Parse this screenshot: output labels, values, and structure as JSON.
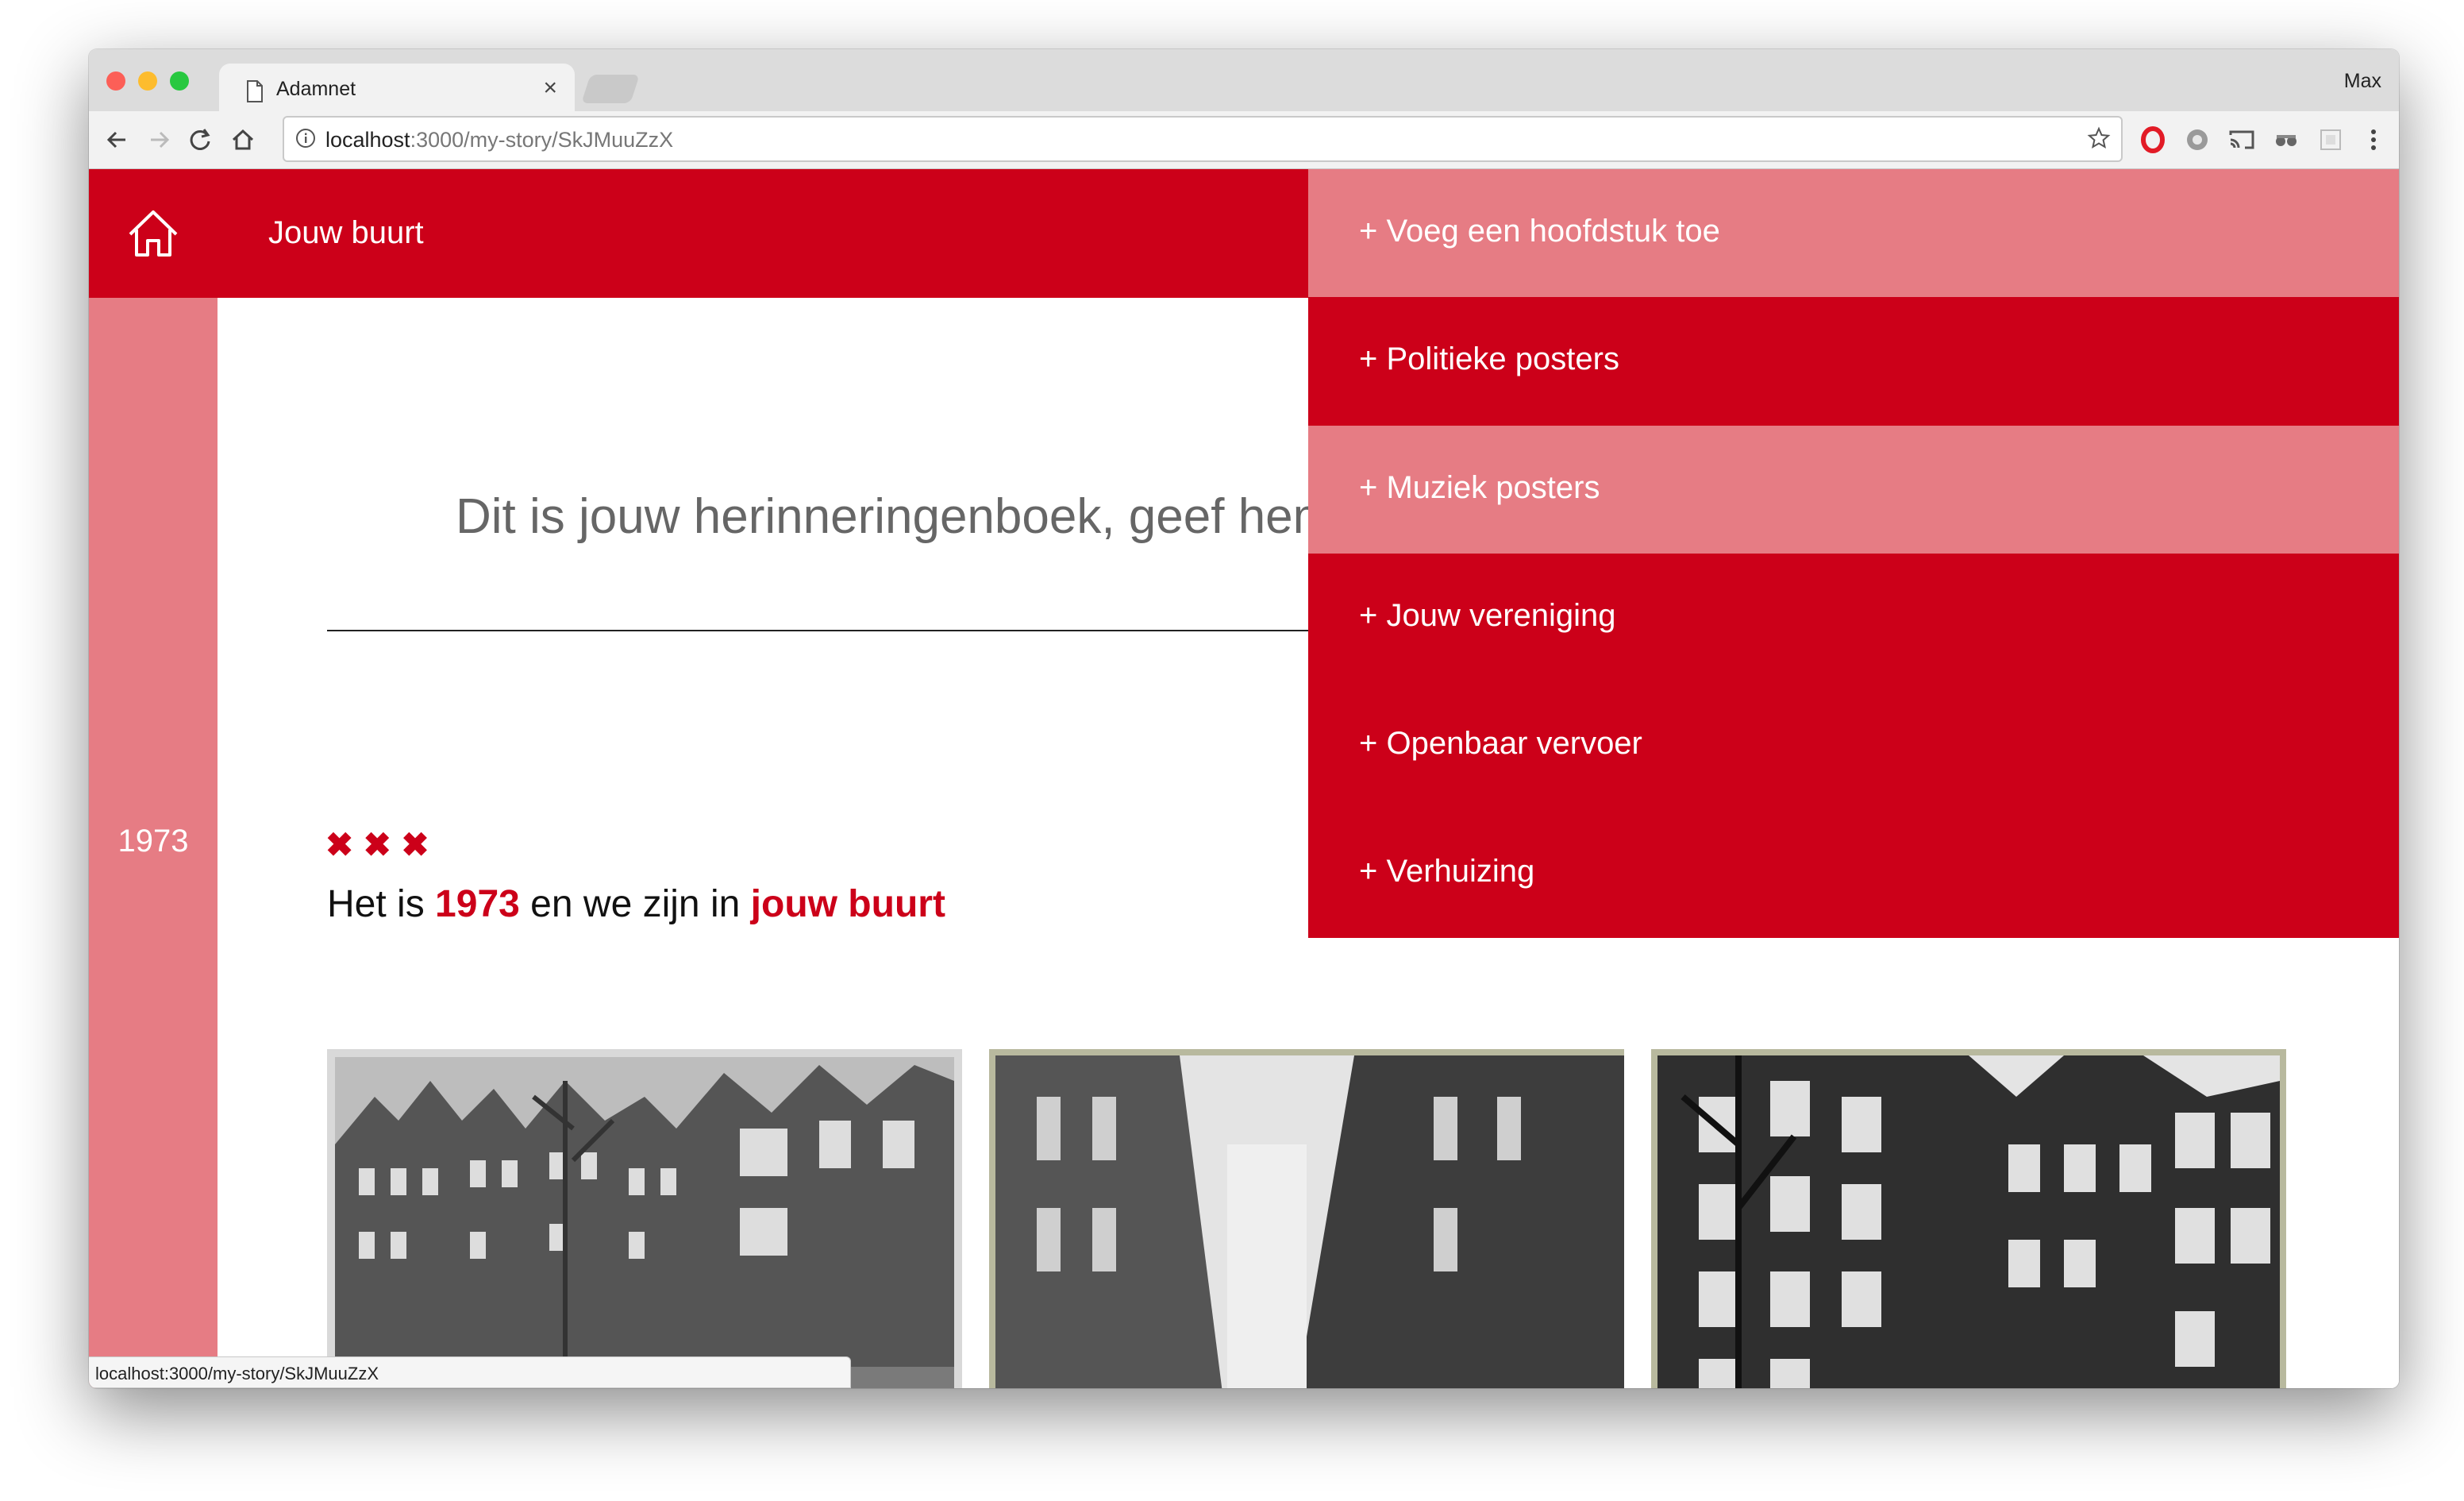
{
  "browser": {
    "tab_title": "Adamnet",
    "profile_name": "Max",
    "url_host": "localhost",
    "url_rest": ":3000/my-story/SkJMuuZzX",
    "status_url": "localhost:3000/my-story/SkJMuuZzX"
  },
  "header": {
    "title": "Jouw buurt"
  },
  "sidebar": {
    "year": "1973"
  },
  "intro": {
    "placeholder": "Dit is jouw herinneringenboek, geef hem hie"
  },
  "chapter": {
    "marks": [
      "✖",
      "✖",
      "✖"
    ],
    "headline_prefix": "Het is",
    "headline_year": "1973",
    "headline_mid": "en we zijn in",
    "headline_place": "jouw buurt"
  },
  "menu": {
    "items": [
      {
        "label": "+ Voeg een hoofdstuk toe",
        "style": "light"
      },
      {
        "label": "+ Politieke posters",
        "style": "dark"
      },
      {
        "label": "+ Muziek posters",
        "style": "light"
      },
      {
        "label": "+ Jouw vereniging",
        "style": "dark"
      },
      {
        "label": "+ Openbaar vervoer",
        "style": "dark"
      },
      {
        "label": "+ Verhuizing",
        "style": "dark"
      }
    ]
  },
  "colors": {
    "brand_red": "#cc0019",
    "brand_pink": "#e67c84"
  }
}
